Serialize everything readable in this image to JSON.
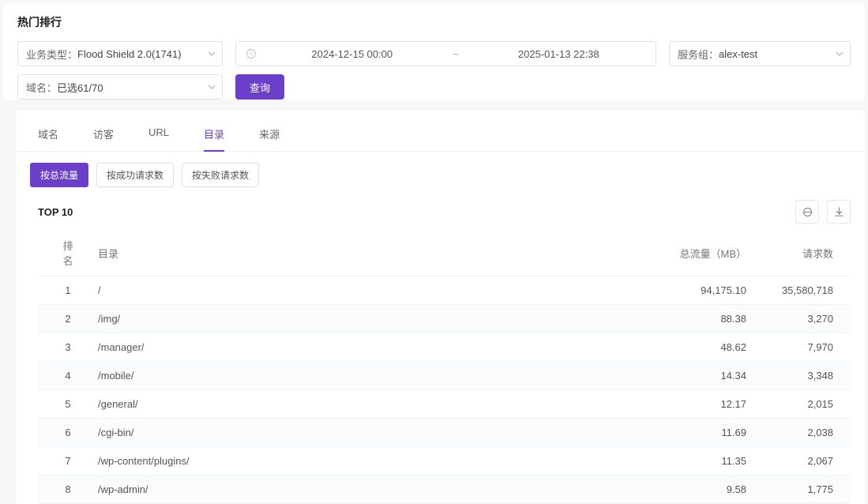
{
  "page": {
    "title": "热门排行"
  },
  "filters": {
    "business_type": {
      "label": "业务类型：",
      "value": "Flood Shield 2.0(1741)"
    },
    "date_start": "2024-12-15 00:00",
    "date_sep": "~",
    "date_end": "2025-01-13 22:38",
    "service_group": {
      "label": "服务组：",
      "value": "alex-test"
    },
    "domain": {
      "label": "域名：",
      "value": "已选61/70"
    },
    "query_btn": "查询"
  },
  "tabs": [
    "域名",
    "访客",
    "URL",
    "目录",
    "来源"
  ],
  "active_tab_index": 3,
  "subtabs": [
    "按总流量",
    "按成功请求数",
    "按失败请求数"
  ],
  "active_subtab_index": 0,
  "table": {
    "top_label": "TOP 10",
    "columns": [
      "排名",
      "目录",
      "总流量（MB）",
      "请求数"
    ],
    "rows": [
      {
        "rank": "1",
        "path": "/",
        "traffic": "94,175.10",
        "requests": "35,580,718"
      },
      {
        "rank": "2",
        "path": "/img/",
        "traffic": "88.38",
        "requests": "3,270"
      },
      {
        "rank": "3",
        "path": "/manager/",
        "traffic": "48.62",
        "requests": "7,970"
      },
      {
        "rank": "4",
        "path": "/mobile/",
        "traffic": "14.34",
        "requests": "3,348"
      },
      {
        "rank": "5",
        "path": "/general/",
        "traffic": "12.17",
        "requests": "2,015"
      },
      {
        "rank": "6",
        "path": "/cgi-bin/",
        "traffic": "11.69",
        "requests": "2,038"
      },
      {
        "rank": "7",
        "path": "/wp-content/plugins/",
        "traffic": "11.35",
        "requests": "2,067"
      },
      {
        "rank": "8",
        "path": "/wp-admin/",
        "traffic": "9.58",
        "requests": "1,775"
      }
    ]
  }
}
